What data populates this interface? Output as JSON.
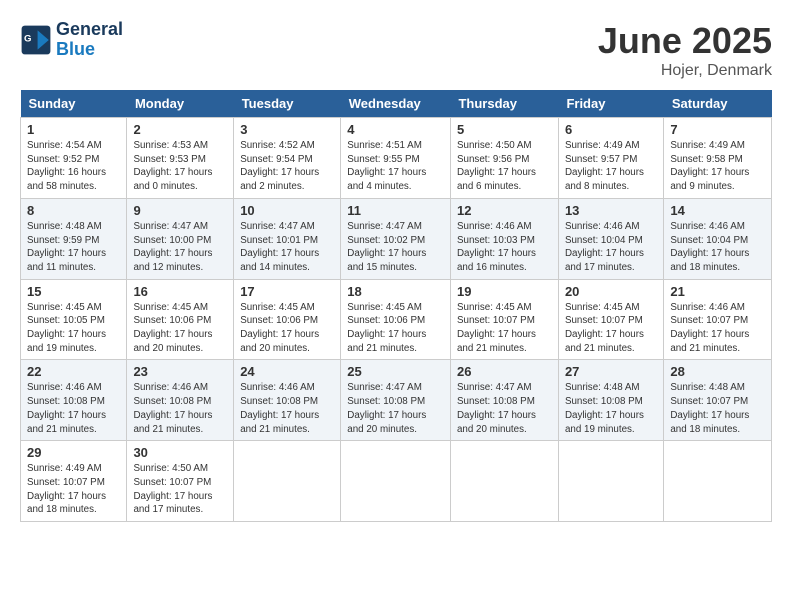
{
  "header": {
    "logo_line1": "General",
    "logo_line2": "Blue",
    "month_title": "June 2025",
    "location": "Hojer, Denmark"
  },
  "days_of_week": [
    "Sunday",
    "Monday",
    "Tuesday",
    "Wednesday",
    "Thursday",
    "Friday",
    "Saturday"
  ],
  "weeks": [
    [
      {
        "day": "1",
        "sunrise": "4:54 AM",
        "sunset": "9:52 PM",
        "daylight": "16 hours and 58 minutes."
      },
      {
        "day": "2",
        "sunrise": "4:53 AM",
        "sunset": "9:53 PM",
        "daylight": "17 hours and 0 minutes."
      },
      {
        "day": "3",
        "sunrise": "4:52 AM",
        "sunset": "9:54 PM",
        "daylight": "17 hours and 2 minutes."
      },
      {
        "day": "4",
        "sunrise": "4:51 AM",
        "sunset": "9:55 PM",
        "daylight": "17 hours and 4 minutes."
      },
      {
        "day": "5",
        "sunrise": "4:50 AM",
        "sunset": "9:56 PM",
        "daylight": "17 hours and 6 minutes."
      },
      {
        "day": "6",
        "sunrise": "4:49 AM",
        "sunset": "9:57 PM",
        "daylight": "17 hours and 8 minutes."
      },
      {
        "day": "7",
        "sunrise": "4:49 AM",
        "sunset": "9:58 PM",
        "daylight": "17 hours and 9 minutes."
      }
    ],
    [
      {
        "day": "8",
        "sunrise": "4:48 AM",
        "sunset": "9:59 PM",
        "daylight": "17 hours and 11 minutes."
      },
      {
        "day": "9",
        "sunrise": "4:47 AM",
        "sunset": "10:00 PM",
        "daylight": "17 hours and 12 minutes."
      },
      {
        "day": "10",
        "sunrise": "4:47 AM",
        "sunset": "10:01 PM",
        "daylight": "17 hours and 14 minutes."
      },
      {
        "day": "11",
        "sunrise": "4:47 AM",
        "sunset": "10:02 PM",
        "daylight": "17 hours and 15 minutes."
      },
      {
        "day": "12",
        "sunrise": "4:46 AM",
        "sunset": "10:03 PM",
        "daylight": "17 hours and 16 minutes."
      },
      {
        "day": "13",
        "sunrise": "4:46 AM",
        "sunset": "10:04 PM",
        "daylight": "17 hours and 17 minutes."
      },
      {
        "day": "14",
        "sunrise": "4:46 AM",
        "sunset": "10:04 PM",
        "daylight": "17 hours and 18 minutes."
      }
    ],
    [
      {
        "day": "15",
        "sunrise": "4:45 AM",
        "sunset": "10:05 PM",
        "daylight": "17 hours and 19 minutes."
      },
      {
        "day": "16",
        "sunrise": "4:45 AM",
        "sunset": "10:06 PM",
        "daylight": "17 hours and 20 minutes."
      },
      {
        "day": "17",
        "sunrise": "4:45 AM",
        "sunset": "10:06 PM",
        "daylight": "17 hours and 20 minutes."
      },
      {
        "day": "18",
        "sunrise": "4:45 AM",
        "sunset": "10:06 PM",
        "daylight": "17 hours and 21 minutes."
      },
      {
        "day": "19",
        "sunrise": "4:45 AM",
        "sunset": "10:07 PM",
        "daylight": "17 hours and 21 minutes."
      },
      {
        "day": "20",
        "sunrise": "4:45 AM",
        "sunset": "10:07 PM",
        "daylight": "17 hours and 21 minutes."
      },
      {
        "day": "21",
        "sunrise": "4:46 AM",
        "sunset": "10:07 PM",
        "daylight": "17 hours and 21 minutes."
      }
    ],
    [
      {
        "day": "22",
        "sunrise": "4:46 AM",
        "sunset": "10:08 PM",
        "daylight": "17 hours and 21 minutes."
      },
      {
        "day": "23",
        "sunrise": "4:46 AM",
        "sunset": "10:08 PM",
        "daylight": "17 hours and 21 minutes."
      },
      {
        "day": "24",
        "sunrise": "4:46 AM",
        "sunset": "10:08 PM",
        "daylight": "17 hours and 21 minutes."
      },
      {
        "day": "25",
        "sunrise": "4:47 AM",
        "sunset": "10:08 PM",
        "daylight": "17 hours and 20 minutes."
      },
      {
        "day": "26",
        "sunrise": "4:47 AM",
        "sunset": "10:08 PM",
        "daylight": "17 hours and 20 minutes."
      },
      {
        "day": "27",
        "sunrise": "4:48 AM",
        "sunset": "10:08 PM",
        "daylight": "17 hours and 19 minutes."
      },
      {
        "day": "28",
        "sunrise": "4:48 AM",
        "sunset": "10:07 PM",
        "daylight": "17 hours and 18 minutes."
      }
    ],
    [
      {
        "day": "29",
        "sunrise": "4:49 AM",
        "sunset": "10:07 PM",
        "daylight": "17 hours and 18 minutes."
      },
      {
        "day": "30",
        "sunrise": "4:50 AM",
        "sunset": "10:07 PM",
        "daylight": "17 hours and 17 minutes."
      },
      null,
      null,
      null,
      null,
      null
    ]
  ]
}
